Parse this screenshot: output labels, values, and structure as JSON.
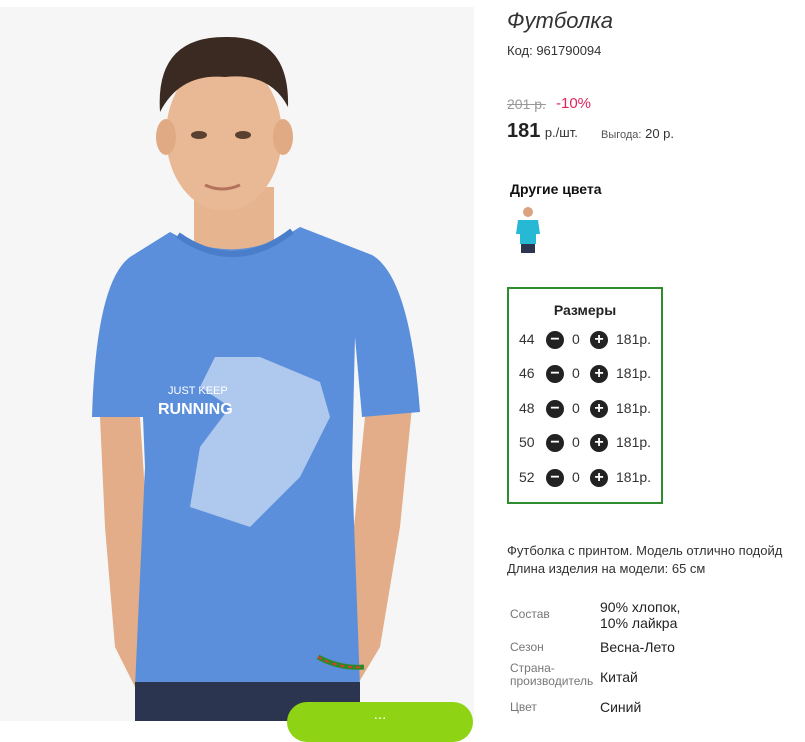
{
  "product": {
    "title": "Футболка",
    "code": "Код: 961790094",
    "old_price": "201 р.",
    "discount": "-10%",
    "price": "181",
    "price_unit": "р./шт.",
    "benefit_label": "Выгода:",
    "benefit_value": "20 р.",
    "print_text_1": "JUST KEEP",
    "print_text_2": "RUNNING"
  },
  "colors": {
    "heading": "Другие цвета",
    "options": [
      {
        "name": "turquoise-variant",
        "color": "#27b8d6"
      }
    ]
  },
  "sizes": {
    "heading": "Размеры",
    "rows": [
      {
        "size": "44",
        "qty": "0",
        "price": "181р."
      },
      {
        "size": "46",
        "qty": "0",
        "price": "181р."
      },
      {
        "size": "48",
        "qty": "0",
        "price": "181р."
      },
      {
        "size": "50",
        "qty": "0",
        "price": "181р."
      },
      {
        "size": "52",
        "qty": "0",
        "price": "181р."
      }
    ]
  },
  "description": {
    "line1": "Футболка с принтом. Модель отлично подойд",
    "line2": "Длина изделия на модели: 65 см"
  },
  "specs": [
    {
      "label": "Состав",
      "value_line1": "90% хлопок,",
      "value_line2": "10% лайкра"
    },
    {
      "label": "Сезон",
      "value": "Весна-Лето"
    },
    {
      "label_line1": "Страна-",
      "label_line2": "производитель",
      "value": "Китай"
    },
    {
      "label": "Цвет",
      "value": "Синий"
    }
  ],
  "button": {
    "label": "..."
  },
  "theme": {
    "accent_green": "#8fd414",
    "sizes_border": "#2e8b2e",
    "discount_red": "#e0245e",
    "shirt_blue": "#5b8fdb"
  }
}
